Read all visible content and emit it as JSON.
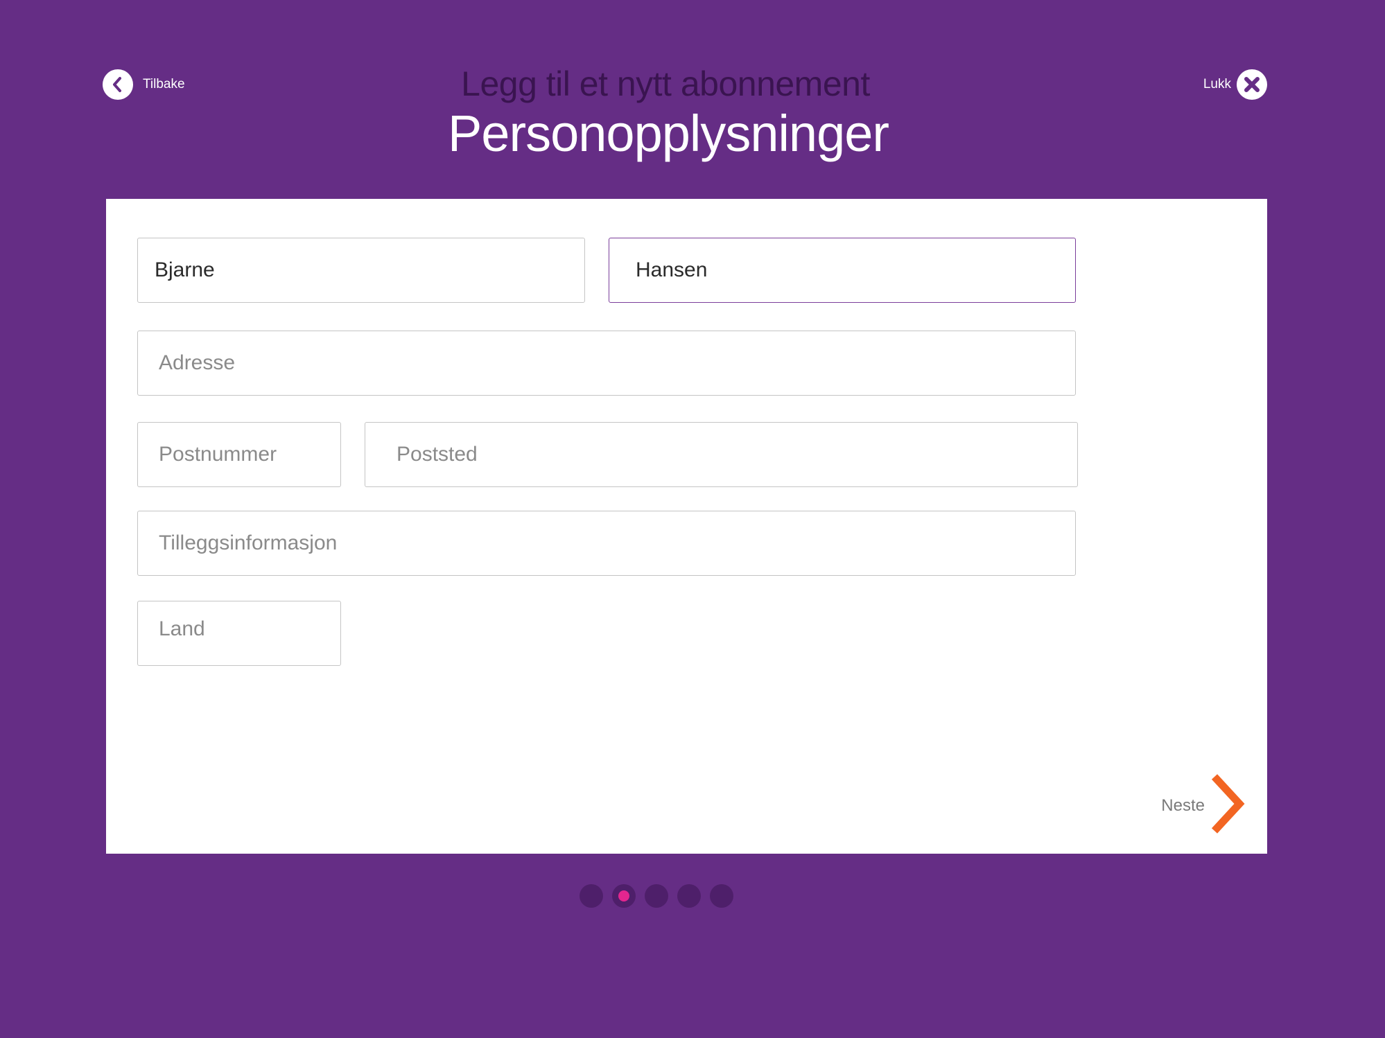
{
  "header": {
    "back_label": "Tilbake",
    "close_label": "Lukk",
    "supertitle": "Legg til et nytt abonnement",
    "title": "Personopplysninger"
  },
  "form": {
    "first_name": {
      "value": "Bjarne",
      "placeholder": ""
    },
    "last_name": {
      "value": "Hansen",
      "placeholder": ""
    },
    "address": {
      "value": "",
      "placeholder": "Adresse"
    },
    "postal_code": {
      "value": "",
      "placeholder": "Postnummer"
    },
    "city": {
      "value": "",
      "placeholder": "Poststed"
    },
    "additional_info": {
      "value": "",
      "placeholder": "Tilleggsinformasjon"
    },
    "country": {
      "value": "",
      "placeholder": "Land"
    }
  },
  "footer": {
    "next_label": "Neste"
  },
  "pager": {
    "total_steps": 5,
    "current_step": 2
  },
  "colors": {
    "background": "#652d85",
    "accent_orange": "#f26522",
    "active_dot": "#e3268f",
    "inactive_dot": "#4e1f6a",
    "focus_border": "#7a3d9a"
  },
  "icons": {
    "back": "chevron-left-icon",
    "close": "close-icon",
    "next": "chevron-right-icon"
  }
}
